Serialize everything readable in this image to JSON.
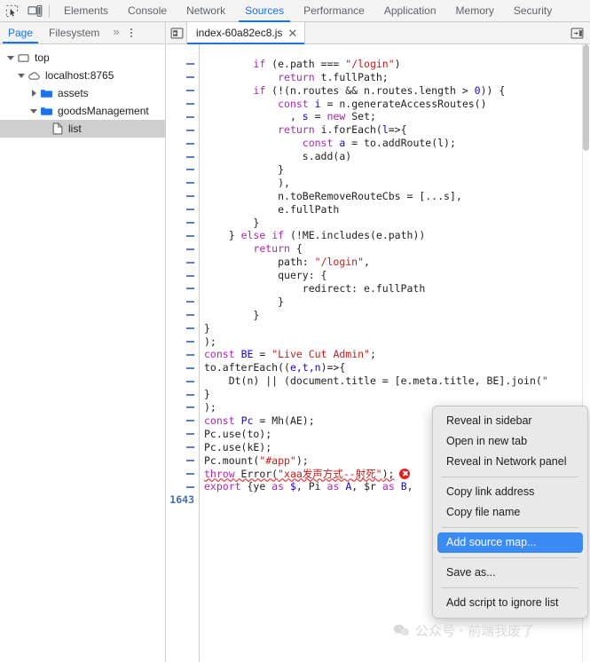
{
  "toolbar": {
    "icons": [
      {
        "name": "inspect-element-icon",
        "label": "Inspect element"
      },
      {
        "name": "device-toolbar-icon",
        "label": "Toggle device toolbar"
      }
    ],
    "tabs": [
      {
        "label": "Elements",
        "active": false
      },
      {
        "label": "Console",
        "active": false
      },
      {
        "label": "Network",
        "active": false
      },
      {
        "label": "Sources",
        "active": true
      },
      {
        "label": "Performance",
        "active": false
      },
      {
        "label": "Application",
        "active": false
      },
      {
        "label": "Memory",
        "active": false
      },
      {
        "label": "Security",
        "active": false
      }
    ]
  },
  "navigator": {
    "tabs": [
      {
        "label": "Page",
        "active": true
      },
      {
        "label": "Filesystem",
        "active": false
      }
    ],
    "overflow_label": "»",
    "more_menu_name": "more-options-icon",
    "tree": [
      {
        "label": "top",
        "depth": 0,
        "expanded": true,
        "icon": "frame-icon",
        "selected": false
      },
      {
        "label": "localhost:8765",
        "depth": 1,
        "expanded": true,
        "icon": "cloud-icon",
        "selected": false
      },
      {
        "label": "assets",
        "depth": 2,
        "expanded": false,
        "icon": "folder-icon",
        "selected": false
      },
      {
        "label": "goodsManagement",
        "depth": 2,
        "expanded": true,
        "icon": "folder-icon",
        "selected": false
      },
      {
        "label": "list",
        "depth": 3,
        "expanded": null,
        "icon": "file-icon",
        "selected": true
      }
    ]
  },
  "editor": {
    "nav_left_icon": "panel-collapse-left-icon",
    "nav_right_icon": "panel-expand-right-icon",
    "file_tab": {
      "label": "index-60a82ec8.js",
      "close_label": "✕"
    },
    "last_line_number": "1643",
    "lines": [
      {
        "indent": 0,
        "segments": [
          {
            "t": "",
            "c": "pl"
          }
        ]
      },
      {
        "indent": 8,
        "segments": [
          {
            "t": "if",
            "c": "kw"
          },
          {
            "t": " (e.path === ",
            "c": "pl"
          },
          {
            "t": "\"/login\"",
            "c": "str"
          },
          {
            "t": ")",
            "c": "pl"
          }
        ]
      },
      {
        "indent": 12,
        "segments": [
          {
            "t": "return",
            "c": "kw"
          },
          {
            "t": " t.fullPath;",
            "c": "pl"
          }
        ]
      },
      {
        "indent": 8,
        "segments": [
          {
            "t": "if",
            "c": "kw"
          },
          {
            "t": " (!(n.routes && n.routes.length > ",
            "c": "pl"
          },
          {
            "t": "0",
            "c": "num"
          },
          {
            "t": ")) {",
            "c": "pl"
          }
        ]
      },
      {
        "indent": 12,
        "segments": [
          {
            "t": "const",
            "c": "kw"
          },
          {
            "t": " ",
            "c": "pl"
          },
          {
            "t": "i",
            "c": "def"
          },
          {
            "t": " = n.generateAccessRoutes()",
            "c": "pl"
          }
        ]
      },
      {
        "indent": 14,
        "segments": [
          {
            "t": ", ",
            "c": "pl"
          },
          {
            "t": "s",
            "c": "def"
          },
          {
            "t": " = ",
            "c": "pl"
          },
          {
            "t": "new",
            "c": "kw"
          },
          {
            "t": " Set;",
            "c": "pl"
          }
        ]
      },
      {
        "indent": 12,
        "segments": [
          {
            "t": "return",
            "c": "kw"
          },
          {
            "t": " i.forEach(",
            "c": "pl"
          },
          {
            "t": "l",
            "c": "def"
          },
          {
            "t": "=>{",
            "c": "pl"
          }
        ]
      },
      {
        "indent": 16,
        "segments": [
          {
            "t": "const",
            "c": "kw"
          },
          {
            "t": " ",
            "c": "pl"
          },
          {
            "t": "a",
            "c": "def"
          },
          {
            "t": " = to.addRoute(l);",
            "c": "pl"
          }
        ]
      },
      {
        "indent": 16,
        "segments": [
          {
            "t": "s.add(a)",
            "c": "pl"
          }
        ]
      },
      {
        "indent": 12,
        "segments": [
          {
            "t": "}",
            "c": "pl"
          }
        ]
      },
      {
        "indent": 12,
        "segments": [
          {
            "t": "),",
            "c": "pl"
          }
        ]
      },
      {
        "indent": 12,
        "segments": [
          {
            "t": "n.toBeRemoveRouteCbs = [...s],",
            "c": "pl"
          }
        ]
      },
      {
        "indent": 12,
        "segments": [
          {
            "t": "e.fullPath",
            "c": "pl"
          }
        ]
      },
      {
        "indent": 8,
        "segments": [
          {
            "t": "}",
            "c": "pl"
          }
        ]
      },
      {
        "indent": 4,
        "segments": [
          {
            "t": "} ",
            "c": "pl"
          },
          {
            "t": "else",
            "c": "kw"
          },
          {
            "t": " ",
            "c": "pl"
          },
          {
            "t": "if",
            "c": "kw"
          },
          {
            "t": " (!ME.includes(e.path))",
            "c": "pl"
          }
        ]
      },
      {
        "indent": 8,
        "segments": [
          {
            "t": "return",
            "c": "kw"
          },
          {
            "t": " {",
            "c": "pl"
          }
        ]
      },
      {
        "indent": 12,
        "segments": [
          {
            "t": "path: ",
            "c": "pl"
          },
          {
            "t": "\"/login\"",
            "c": "str"
          },
          {
            "t": ",",
            "c": "pl"
          }
        ]
      },
      {
        "indent": 12,
        "segments": [
          {
            "t": "query: {",
            "c": "pl"
          }
        ]
      },
      {
        "indent": 16,
        "segments": [
          {
            "t": "redirect: e.fullPath",
            "c": "pl"
          }
        ]
      },
      {
        "indent": 12,
        "segments": [
          {
            "t": "}",
            "c": "pl"
          }
        ]
      },
      {
        "indent": 8,
        "segments": [
          {
            "t": "}",
            "c": "pl"
          }
        ]
      },
      {
        "indent": 0,
        "segments": [
          {
            "t": "}",
            "c": "pl"
          }
        ]
      },
      {
        "indent": 0,
        "segments": [
          {
            "t": ");",
            "c": "pl"
          }
        ]
      },
      {
        "indent": 0,
        "segments": [
          {
            "t": "const",
            "c": "kw"
          },
          {
            "t": " ",
            "c": "pl"
          },
          {
            "t": "BE",
            "c": "def"
          },
          {
            "t": " = ",
            "c": "pl"
          },
          {
            "t": "\"Live Cut Admin\"",
            "c": "str"
          },
          {
            "t": ";",
            "c": "pl"
          }
        ]
      },
      {
        "indent": 0,
        "segments": [
          {
            "t": "to.afterEach((",
            "c": "pl"
          },
          {
            "t": "e,t,n",
            "c": "def"
          },
          {
            "t": ")=>{",
            "c": "pl"
          }
        ]
      },
      {
        "indent": 4,
        "segments": [
          {
            "t": "Dt(n) || (document.title = [e.meta.title, BE].join(",
            "c": "pl"
          },
          {
            "t": "\"",
            "c": "str"
          }
        ]
      },
      {
        "indent": 0,
        "segments": [
          {
            "t": "}",
            "c": "pl"
          }
        ]
      },
      {
        "indent": 0,
        "segments": [
          {
            "t": ");",
            "c": "pl"
          }
        ]
      },
      {
        "indent": 0,
        "segments": [
          {
            "t": "const",
            "c": "kw"
          },
          {
            "t": " ",
            "c": "pl"
          },
          {
            "t": "Pc",
            "c": "def"
          },
          {
            "t": " = Mh(AE);",
            "c": "pl"
          }
        ]
      },
      {
        "indent": 0,
        "segments": [
          {
            "t": "Pc.use(to);",
            "c": "pl"
          }
        ]
      },
      {
        "indent": 0,
        "segments": [
          {
            "t": "Pc.use(kE);",
            "c": "pl"
          }
        ]
      },
      {
        "indent": 0,
        "segments": [
          {
            "t": "Pc.mount(",
            "c": "pl"
          },
          {
            "t": "\"#app\"",
            "c": "str"
          },
          {
            "t": ");",
            "c": "pl"
          }
        ]
      },
      {
        "indent": 0,
        "error": true,
        "segments": [
          {
            "t": "throw",
            "c": "kw"
          },
          {
            "t": " Error(",
            "c": "pl"
          },
          {
            "t": "\"xaa发声方式--射死\"",
            "c": "str"
          },
          {
            "t": ");",
            "c": "pl"
          }
        ]
      },
      {
        "indent": 0,
        "segments": [
          {
            "t": "export",
            "c": "kw"
          },
          {
            "t": " {ye ",
            "c": "pl"
          },
          {
            "t": "as",
            "c": "kw"
          },
          {
            "t": " ",
            "c": "pl"
          },
          {
            "t": "$",
            "c": "def"
          },
          {
            "t": ", Pi ",
            "c": "pl"
          },
          {
            "t": "as",
            "c": "kw"
          },
          {
            "t": " ",
            "c": "pl"
          },
          {
            "t": "A",
            "c": "def"
          },
          {
            "t": ", $r ",
            "c": "pl"
          },
          {
            "t": "as",
            "c": "kw"
          },
          {
            "t": " ",
            "c": "pl"
          },
          {
            "t": "B",
            "c": "def"
          },
          {
            "t": ",",
            "c": "pl"
          }
        ]
      }
    ]
  },
  "context_menu": {
    "items": [
      {
        "label": "Reveal in sidebar",
        "highlighted": false,
        "separator_after": false
      },
      {
        "label": "Open in new tab",
        "highlighted": false,
        "separator_after": false
      },
      {
        "label": "Reveal in Network panel",
        "highlighted": false,
        "separator_after": true
      },
      {
        "label": "Copy link address",
        "highlighted": false,
        "separator_after": false
      },
      {
        "label": "Copy file name",
        "highlighted": false,
        "separator_after": true
      },
      {
        "label": "Add source map...",
        "highlighted": true,
        "separator_after": true
      },
      {
        "label": "Save as...",
        "highlighted": false,
        "separator_after": true
      },
      {
        "label": "Add script to ignore list",
        "highlighted": false,
        "separator_after": false
      }
    ],
    "highlight_color": "#3b8bf5"
  },
  "watermark": {
    "icon_name": "wechat-icon",
    "text": "公众号 · 前端我废了"
  }
}
